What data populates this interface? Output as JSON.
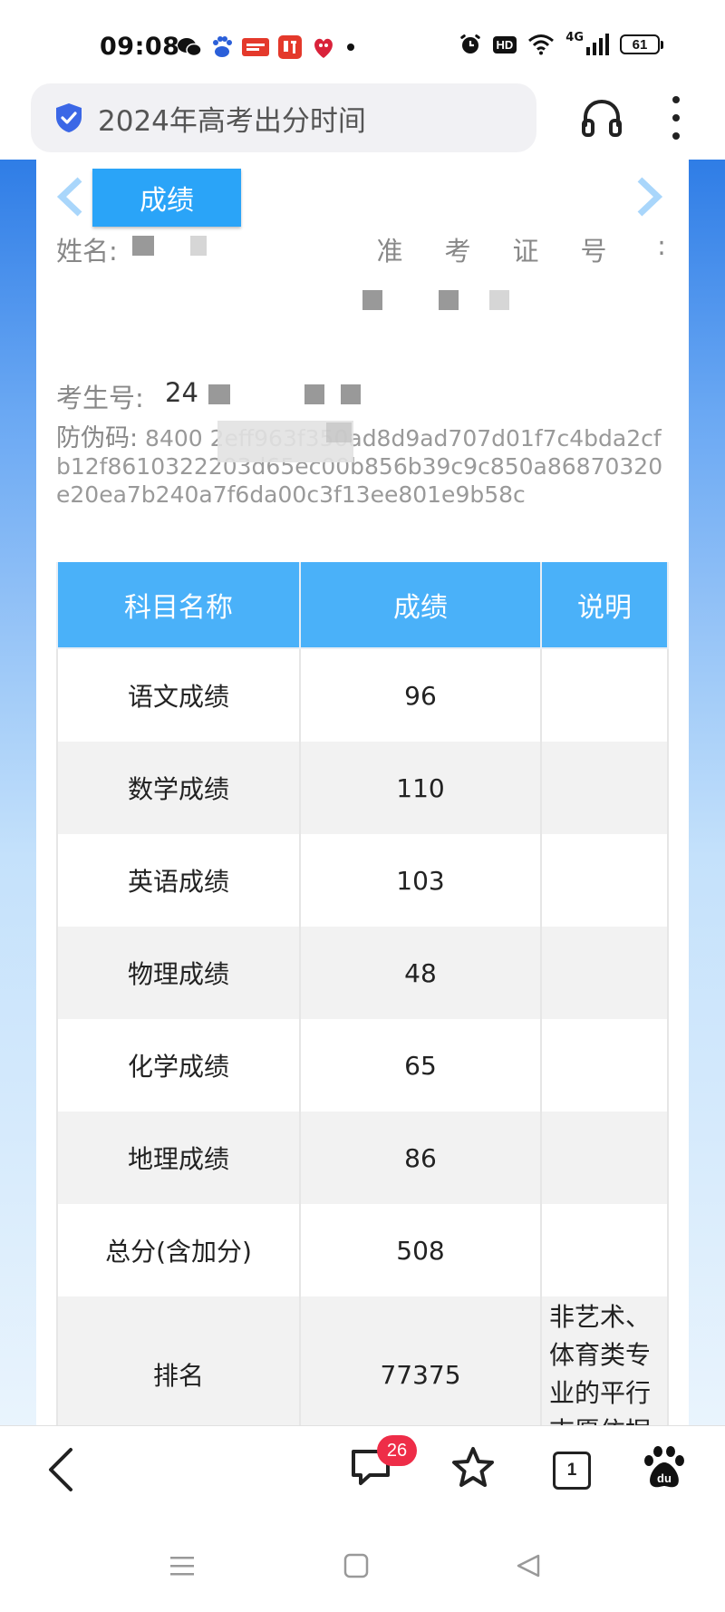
{
  "status_bar": {
    "time": "09:08",
    "network": "4G",
    "battery": "61",
    "app_icons": [
      "wechat-icon",
      "baidu-icon",
      "toutiao-icon",
      "ting-icon",
      "618-icon"
    ]
  },
  "browser": {
    "url_text": "2024年高考出分时间"
  },
  "page": {
    "tab_label": "成绩",
    "name_label": "姓名:",
    "admission_label_chars": [
      "准",
      "考",
      "证",
      "号",
      ":"
    ],
    "candidate_label": "考生号:",
    "candidate_prefix": "24",
    "code_label": "防伪码:",
    "code_value": " 8400            2eff963f350ad8d9ad707d01f7c4bda2cfb12f8610322203d65ec00b856b39c9c850a86870320e20ea7b240a7f6da00c3f13ee801e9b58c"
  },
  "table": {
    "headers": [
      "科目名称",
      "成绩",
      "说明"
    ],
    "rows": [
      {
        "subject": "语文成绩",
        "score": "96",
        "note": ""
      },
      {
        "subject": "数学成绩",
        "score": "110",
        "note": ""
      },
      {
        "subject": "英语成绩",
        "score": "103",
        "note": ""
      },
      {
        "subject": "物理成绩",
        "score": "48",
        "note": ""
      },
      {
        "subject": "化学成绩",
        "score": "65",
        "note": ""
      },
      {
        "subject": "地理成绩",
        "score": "86",
        "note": ""
      },
      {
        "subject": "总分(含加分)",
        "score": "508",
        "note": ""
      },
      {
        "subject": "排名",
        "score": "77375",
        "note": "非艺术、体育类专业的平行志愿依据"
      }
    ]
  },
  "bottom_nav": {
    "comment_badge": "26",
    "tab_count": "1"
  },
  "colors": {
    "accent": "#2aa4f8",
    "table_header": "#4ab1f9",
    "badge": "#ee2d48"
  }
}
